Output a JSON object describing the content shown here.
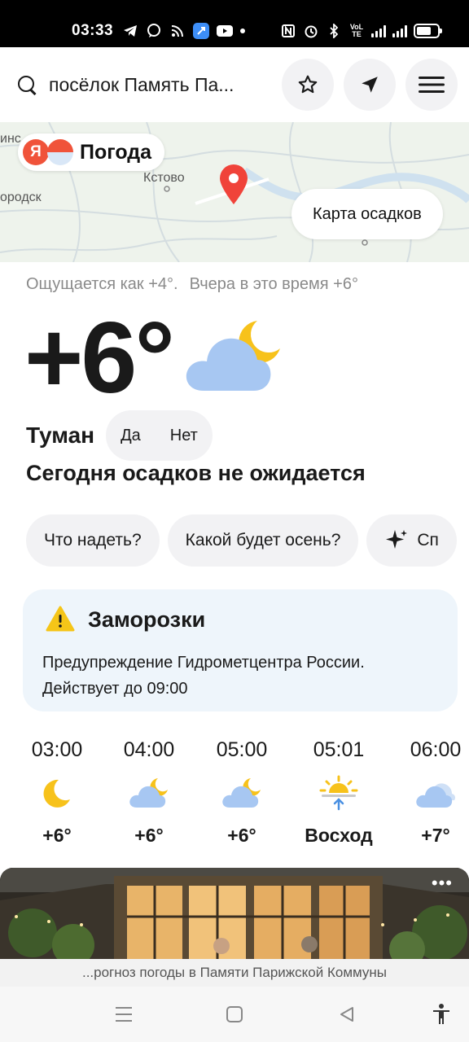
{
  "status_bar": {
    "time": "03:33",
    "network": "4G",
    "battery_level": 0.7
  },
  "header": {
    "search_text": "посёлок Память Па...",
    "icons": [
      "search-icon",
      "star-icon",
      "location-arrow-icon",
      "menu-icon"
    ]
  },
  "map": {
    "logo_letter": "Я",
    "logo_text": "Погода",
    "labels": [
      "Кстово",
      "ородск",
      "инс"
    ],
    "precip_map_button": "Карта осадков"
  },
  "current": {
    "feels_like": "Ощущается как +4°.",
    "yesterday": "Вчера в это время +6°",
    "temperature": "+6°",
    "condition": "Туман",
    "yes_label": "Да",
    "no_label": "Нет",
    "precip_summary": "Сегодня осадков не ожидается"
  },
  "chips": [
    "Что надеть?",
    "Какой будет осень?",
    "Сп"
  ],
  "alert": {
    "title": "Заморозки",
    "line1": "Предупреждение Гидрометцентра России.",
    "line2": "Действует до 09:00",
    "color": "#f5c518"
  },
  "hourly": [
    {
      "time": "03:00",
      "icon": "moon-icon",
      "temp": "+6°"
    },
    {
      "time": "04:00",
      "icon": "partly-cloudy-night-icon",
      "temp": "+6°"
    },
    {
      "time": "05:00",
      "icon": "partly-cloudy-night-icon",
      "temp": "+6°"
    },
    {
      "time": "05:01",
      "icon": "sunrise-icon",
      "temp": "Восход"
    },
    {
      "time": "06:00",
      "icon": "cloudy-icon",
      "temp": "+7°"
    }
  ],
  "banner": {
    "more": "•••"
  },
  "bottom": {
    "url_text": "...рогноз погоды в Памяти Парижской Коммуны"
  }
}
